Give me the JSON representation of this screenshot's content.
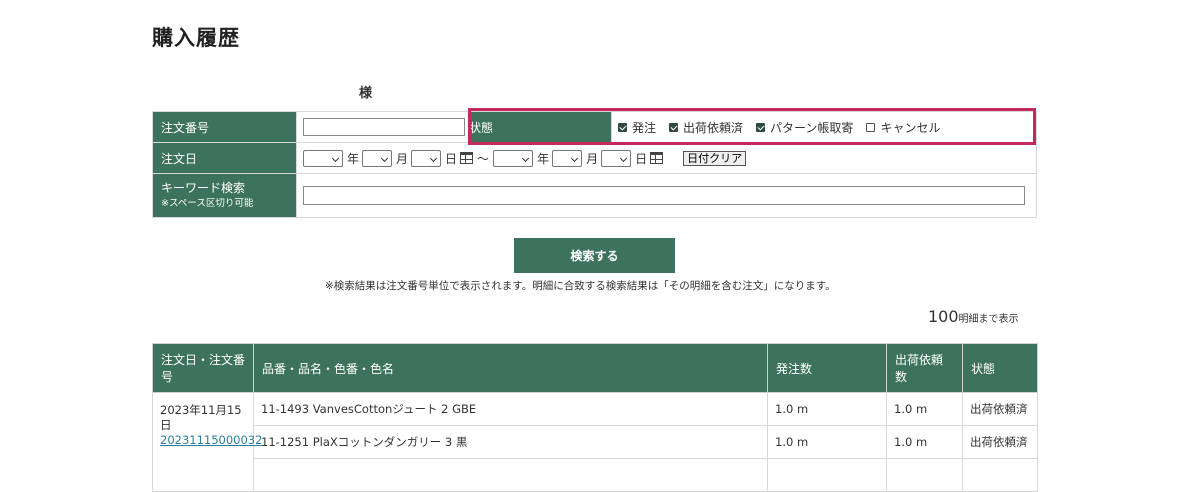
{
  "page": {
    "title": "購入履歴",
    "customer_suffix": "様"
  },
  "search": {
    "order_number_label": "注文番号",
    "order_number_value": "",
    "status_label": "状態",
    "statuses": [
      {
        "label": "発注",
        "checked": true
      },
      {
        "label": "出荷依頼済",
        "checked": true
      },
      {
        "label": "パターン帳取寄",
        "checked": true
      },
      {
        "label": "キャンセル",
        "checked": false
      }
    ],
    "date_label": "注文日",
    "date_units": {
      "year": "年",
      "month": "月",
      "day": "日",
      "tilde": "〜"
    },
    "clear_label": "日付クリア",
    "keyword_label": "キーワード検索",
    "keyword_sub": "※スペース区切り可能",
    "keyword_value": "",
    "button_label": "検索する",
    "note": "※検索結果は注文番号単位で表示されます。明細に合致する検索結果は「その明細を含む注文」になります。"
  },
  "results": {
    "display_count": "100",
    "display_count_suffix": "明細まで表示",
    "columns": [
      "注文日・注文番号",
      "品番・品名・色番・色名",
      "発注数",
      "出荷依頼数",
      "状態"
    ],
    "order": {
      "date": "2023年11月15日",
      "number": "20231115000032"
    },
    "rows": [
      {
        "item": "11-1493 VanvesCottonジュート 2 GBE",
        "qty": "1.0 m",
        "ship": "1.0 m",
        "status": "出荷依頼済"
      },
      {
        "item": "11-1251 PlaXコットンダンガリー 3 黒",
        "qty": "1.0 m",
        "ship": "1.0 m",
        "status": "出荷依頼済"
      }
    ]
  },
  "colors": {
    "accent": "#3d735e",
    "highlight": "#c42a5c",
    "link": "#2a7f9e"
  }
}
